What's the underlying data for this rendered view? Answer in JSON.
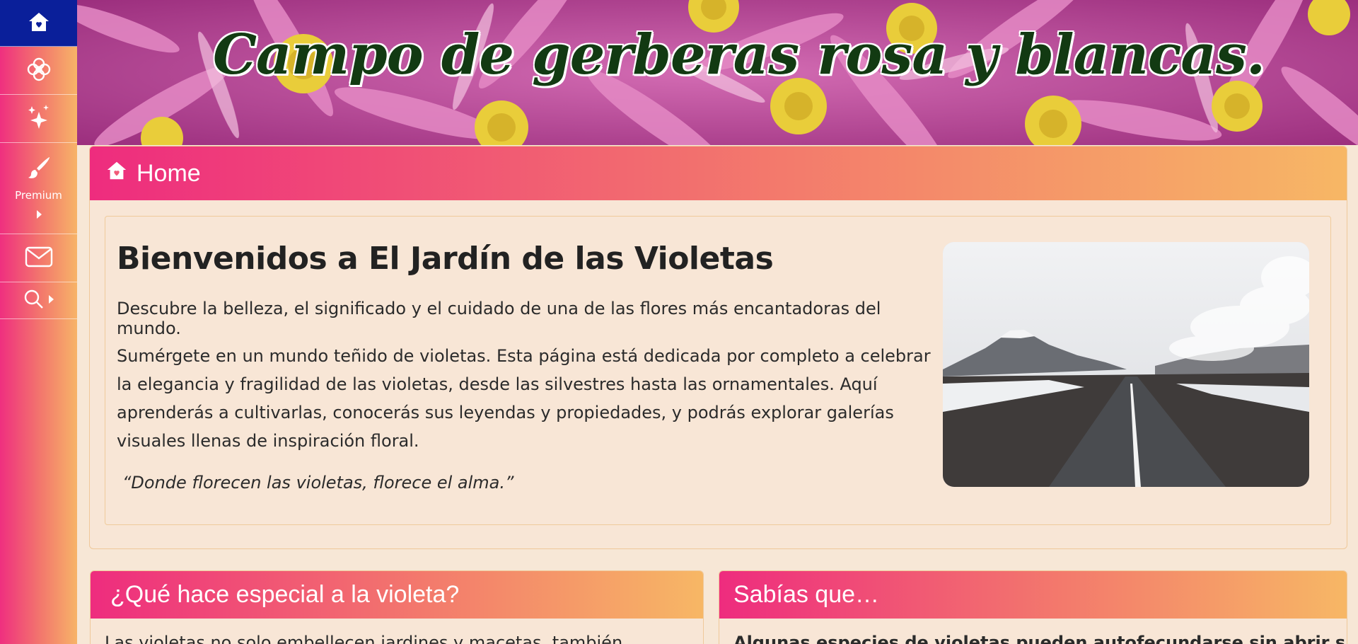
{
  "sidebar": {
    "items": [
      {
        "icon": "home-icon"
      },
      {
        "icon": "flower-icon"
      },
      {
        "icon": "sparkles-icon"
      },
      {
        "icon": "brush-icon",
        "label": "Premium"
      },
      {
        "icon": "mail-icon"
      },
      {
        "icon": "search-icon"
      }
    ]
  },
  "banner": {
    "title": "Campo de gerberas rosa y blancas."
  },
  "home": {
    "header": "Home",
    "title": "Bienvenidos a El Jardín de las Violetas",
    "lead": "Descubre la belleza, el significado y el cuidado de una de las flores más encantadoras del mundo.",
    "body": "Sumérgete en un mundo teñido de violetas. Esta página está dedicada por completo a celebrar la elegancia y fragilidad de las violetas, desde las silvestres hasta las ornamentales. Aquí aprenderás a cultivarlas, conocerás sus leyendas y propiedades, y podrás explorar galerías visuales llenas de inspiración floral.",
    "quote": "“Donde florecen las violetas, florece el alma.”"
  },
  "cards": {
    "special": {
      "header": "¿Qué hace especial a la violeta?",
      "text": "Las violetas no solo embellecen jardines y macetas, también"
    },
    "facts": {
      "header": "Sabías que…",
      "text": "Algunas especies de violetas pueden autofecundarse sin abrir sus"
    }
  },
  "colors": {
    "accent_pink": "#ee2c7e",
    "accent_orange": "#f7b765",
    "sidebar_active": "#0a1f9a",
    "page_bg": "#f8e6d6",
    "banner_title": "#123a12"
  }
}
